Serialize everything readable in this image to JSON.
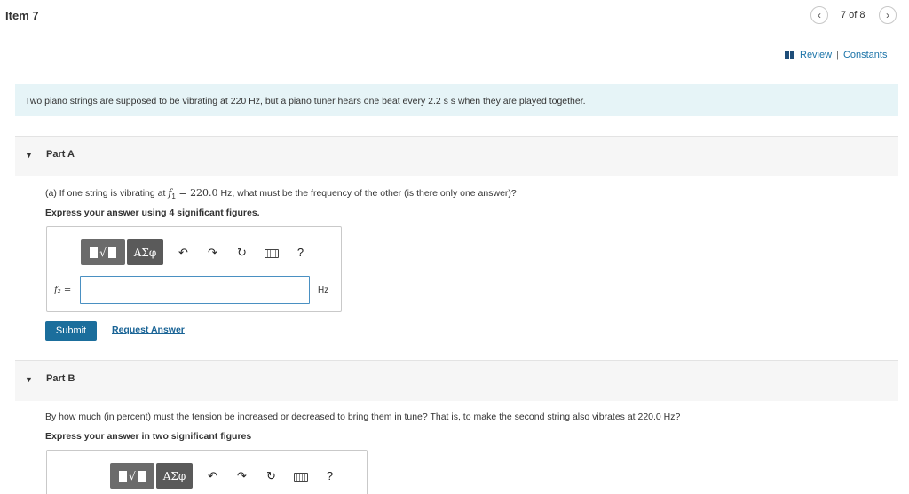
{
  "header": {
    "title": "Item 7",
    "page_count": "7 of 8",
    "prev_icon": "chevron-left-icon",
    "next_icon": "chevron-right-icon"
  },
  "links": {
    "review": "Review",
    "separator": "|",
    "constants": "Constants"
  },
  "intro": {
    "text": "Two piano strings are supposed to be vibrating at 220 Hz, but a piano tuner hears one beat every 2.2 s  s when they are played together."
  },
  "part_a": {
    "label": "Part A",
    "question_prefix": "(a) If one string is vibrating at ",
    "question_var": "f",
    "question_sub": "1",
    "question_eq": " = ",
    "question_value": "220.0",
    "question_suffix": " Hz, what must be the frequency of the other (is there only one answer)?",
    "instruction": "Express your answer using 4 significant figures.",
    "field_label": "f₂ =",
    "field_value": "",
    "unit": "Hz",
    "submit_label": "Submit",
    "request_label": "Request Answer"
  },
  "part_b": {
    "label": "Part B",
    "question": "By how much (in percent) must the tension be increased or decreased to bring them in tune? That is, to make the second string also vibrates at 220.0 Hz?",
    "instruction": "Express your answer in two significant figures"
  },
  "toolbar": {
    "greek": "ΑΣφ",
    "sqrt": "√",
    "undo": "↶",
    "redo": "↷",
    "reset": "↻",
    "help": "?"
  },
  "colors": {
    "accent": "#1b6e9c",
    "link": "#1a73a8",
    "intro_bg": "#e6f4f7"
  }
}
